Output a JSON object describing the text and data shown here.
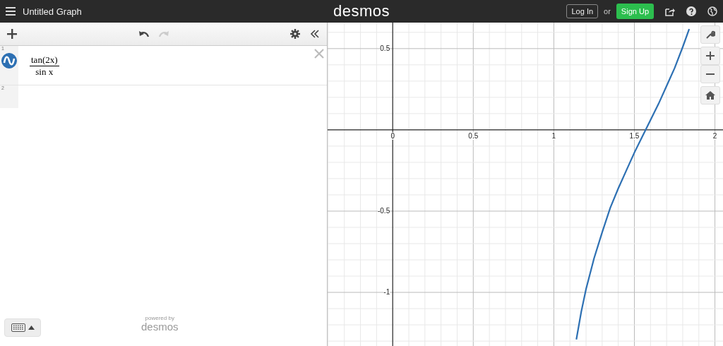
{
  "header": {
    "title": "Untitled Graph",
    "logo": "desmos",
    "login": "Log In",
    "or": "or",
    "signup": "Sign Up"
  },
  "expressions": [
    {
      "number": "1",
      "numerator": "tan(2x)",
      "denominator": "sin x",
      "color": "#2d70b3",
      "visible": true
    },
    {
      "number": "2"
    }
  ],
  "footer": {
    "powered": "powered by",
    "brand": "desmos"
  },
  "graph": {
    "chart_data": {
      "type": "line",
      "grid": true,
      "xlim": [
        -0.404,
        2.05
      ],
      "ylim": [
        -1.33,
        0.66
      ],
      "xticks": [
        {
          "value": 0,
          "label": "0"
        },
        {
          "value": 0.5,
          "label": "0.5"
        },
        {
          "value": 1,
          "label": "1"
        },
        {
          "value": 1.5,
          "label": "1.5"
        },
        {
          "value": 2,
          "label": "2"
        }
      ],
      "yticks": [
        {
          "value": 0.5,
          "label": "0.5"
        },
        {
          "value": -0.5,
          "label": "-0.5"
        },
        {
          "value": -1,
          "label": "-1"
        }
      ],
      "x": [
        1.14,
        1.17,
        1.2,
        1.25,
        1.3,
        1.35,
        1.4,
        1.45,
        1.5,
        1.55,
        1.6,
        1.65,
        1.7,
        1.75,
        1.8,
        1.84
      ],
      "series": [
        {
          "color": "#2d70b3",
          "values": [
            -1.29,
            -1.12,
            -0.98,
            -0.79,
            -0.63,
            -0.48,
            -0.36,
            -0.25,
            -0.14,
            -0.04,
            0.06,
            0.16,
            0.27,
            0.38,
            0.51,
            0.62
          ]
        }
      ]
    }
  }
}
